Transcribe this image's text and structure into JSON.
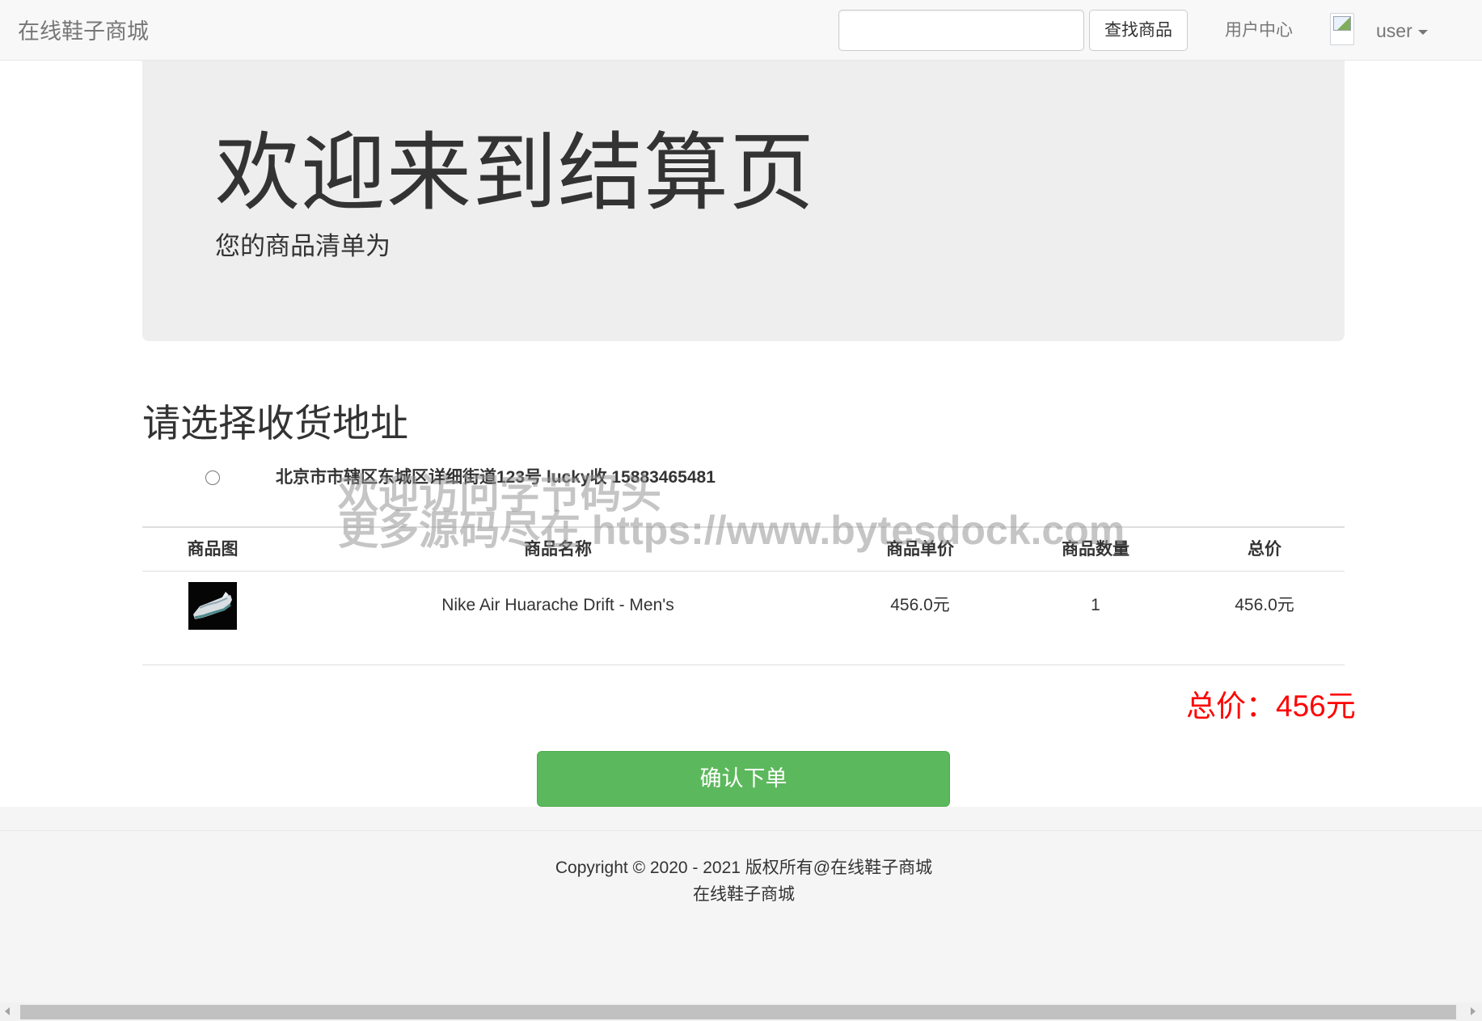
{
  "navbar": {
    "brand": "在线鞋子商城",
    "search": {
      "value": "",
      "placeholder": "",
      "button_label": "查找商品"
    },
    "user_center": "用户中心",
    "user_name": "user"
  },
  "jumbotron": {
    "title": "欢迎来到结算页",
    "subtitle": "您的商品清单为"
  },
  "address": {
    "heading": "请选择收货地址",
    "options": [
      {
        "label": "北京市市辖区东城区详细街道123号 lucky收 15883465481",
        "selected": false
      }
    ]
  },
  "table": {
    "headers": [
      "商品图",
      "商品名称",
      "商品单价",
      "商品数量",
      "总价"
    ],
    "rows": [
      {
        "image_icon": "shoe-thumbnail",
        "name": "Nike Air Huarache Drift - Men's",
        "unit_price": "456.0元",
        "quantity": "1",
        "total": "456.0元"
      }
    ]
  },
  "summary": {
    "total_label": "总价：456元"
  },
  "actions": {
    "confirm_label": "确认下单"
  },
  "footer": {
    "copyright": "Copyright © 2020 - 2021 版权所有@在线鞋子商城",
    "site_name": "在线鞋子商城"
  },
  "watermark": {
    "line1": "欢迎访问字节码头",
    "line2": "更多源码尽在  https://www.bytesdock.com"
  },
  "colors": {
    "accent_green": "#5cb85c",
    "total_red": "#ff0000",
    "navbar_bg": "#f8f8f8",
    "jumbotron_bg": "#eeeeee"
  }
}
